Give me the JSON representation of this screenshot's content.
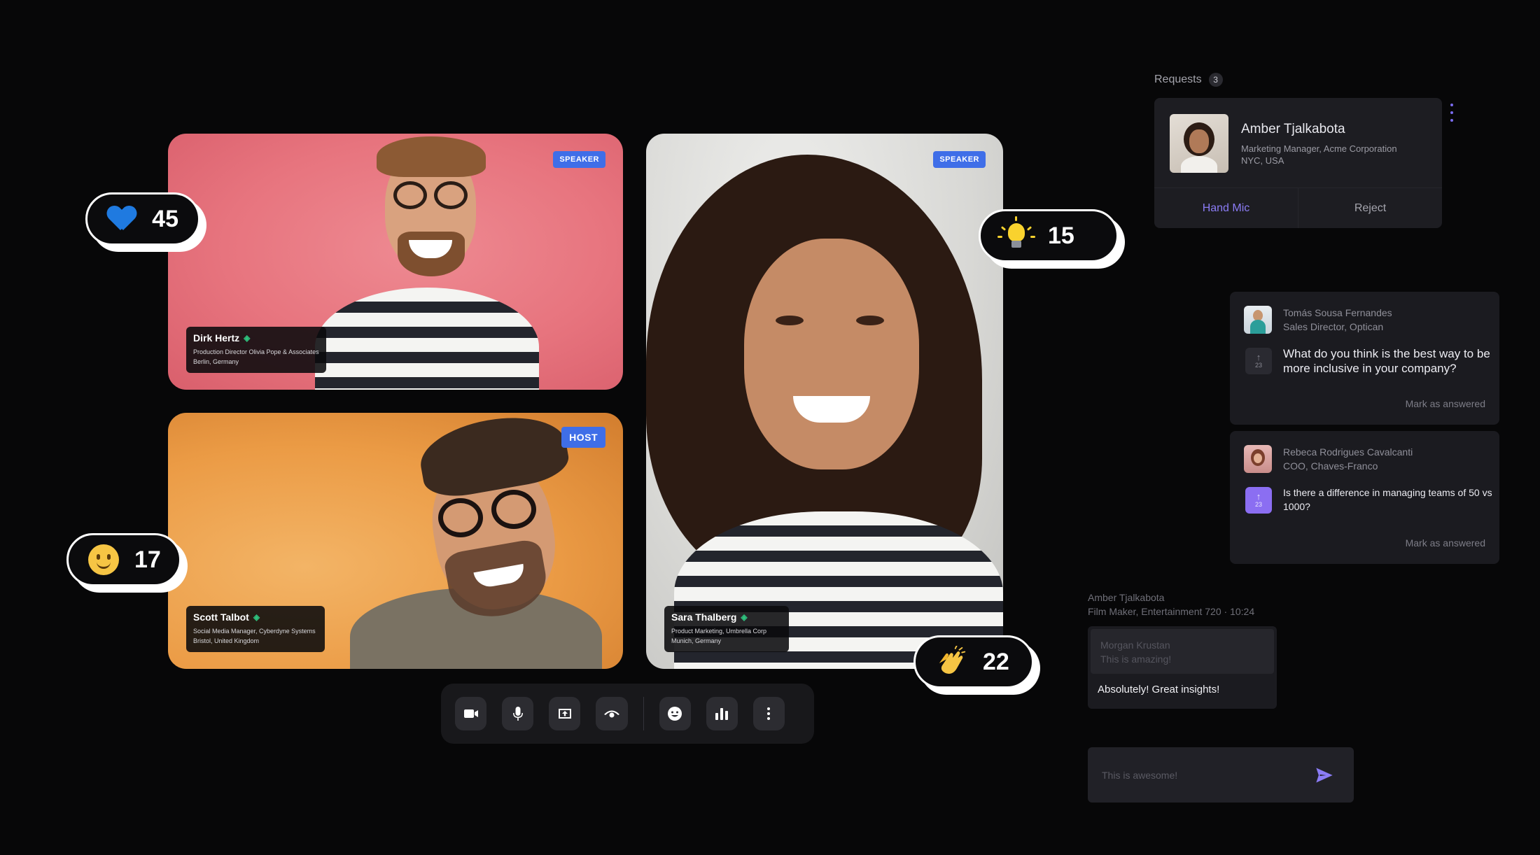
{
  "tiles": [
    {
      "role": "SPEAKER",
      "name": "Dirk Hertz",
      "line1": "Production Director Olivia Pope & Associates",
      "line2": "Berlin, Germany"
    },
    {
      "role": "HOST",
      "name": "Scott Talbot",
      "line1": "Social Media Manager, Cyberdyne Systems",
      "line2": "Bristol, United Kingdom"
    },
    {
      "role": "SPEAKER",
      "name": "Sara Thalberg",
      "line1": "Product Marketing, Umbrella Corp",
      "line2": "Munich, Germany"
    }
  ],
  "reactions": {
    "heart": {
      "icon": "blue-heart",
      "count": "45"
    },
    "bulb": {
      "icon": "light-bulb",
      "count": "15"
    },
    "smile": {
      "icon": "smiling-face",
      "count": "17"
    },
    "clap": {
      "icon": "clapping-hands",
      "count": "22"
    }
  },
  "controls": [
    "camera-icon",
    "microphone-icon",
    "share-screen-icon",
    "eye-icon",
    "emoji-icon",
    "poll-icon",
    "more-icon"
  ],
  "requests": {
    "label": "Requests",
    "count": "3",
    "card": {
      "name": "Amber Tjalkabota",
      "title": "Marketing Manager, Acme Corporation",
      "location": "NYC, USA",
      "accept": "Hand Mic",
      "reject": "Reject"
    }
  },
  "questions": [
    {
      "name": "Tomás Sousa Fernandes",
      "role": "Sales Director, Optican",
      "votes": "23",
      "text": "What do you think is the best way to be more inclusive in your company?",
      "action": "Mark as answered"
    },
    {
      "name": "Rebeca Rodrigues Cavalcanti",
      "role": "COO, Chaves-Franco",
      "votes": "23",
      "text": "Is there a difference in managing teams of 50 vs 1000?",
      "action": "Mark as answered"
    }
  ],
  "chat": {
    "author": "Amber Tjalkabota",
    "meta": "Film Maker, Entertainment 720 · 10:24",
    "quote_author": "Morgan Krustan",
    "quote_text": "This is amazing!",
    "message": "Absolutely! Great insights!",
    "placeholder": "This is awesome!"
  },
  "colors": {
    "background": "#070708",
    "accent": "#8b7cf5",
    "role_badge": "#3f6ee8",
    "speaking": "#2ec27e"
  }
}
